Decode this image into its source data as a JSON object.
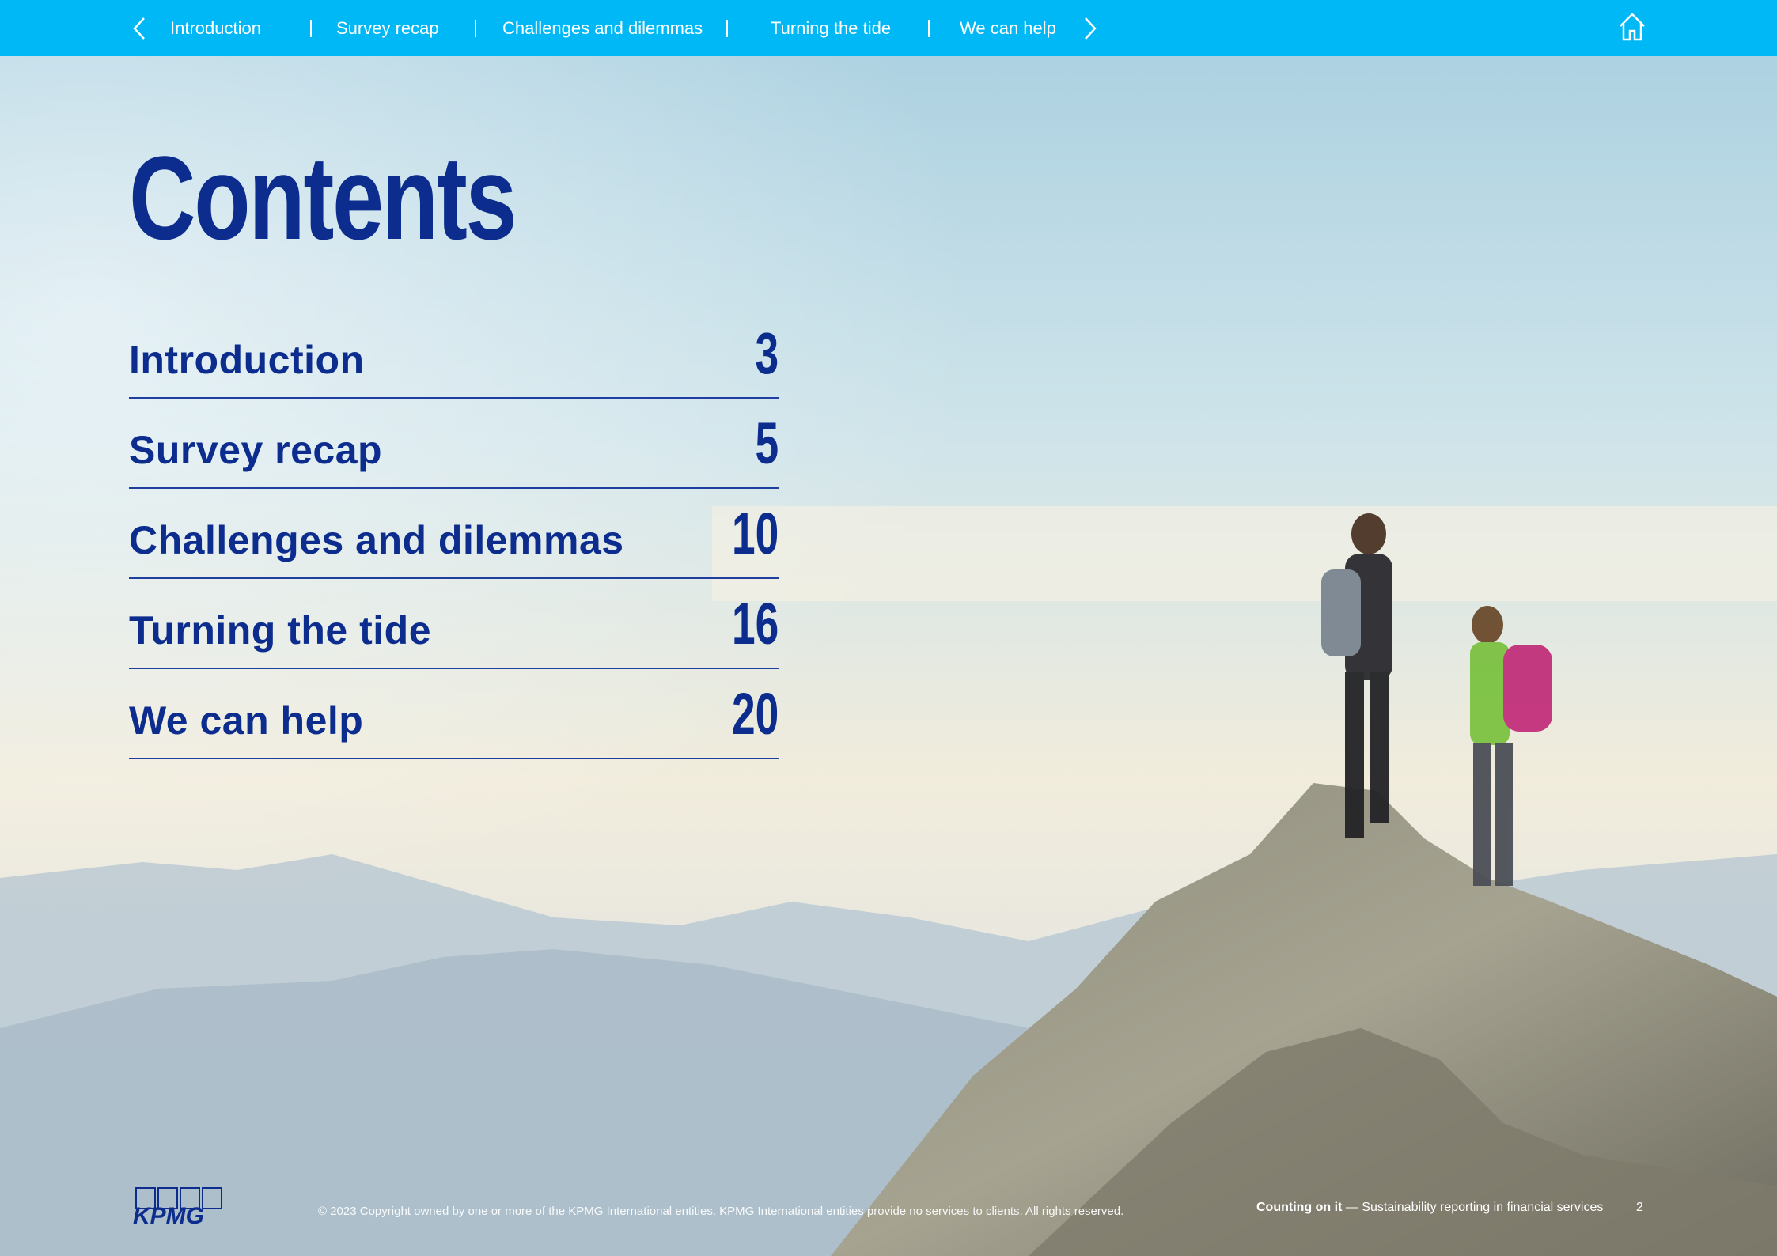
{
  "nav": {
    "items": [
      {
        "label": "Introduction"
      },
      {
        "label": "Survey recap"
      },
      {
        "label": "Challenges and dilemmas"
      },
      {
        "label": "Turning the tide"
      },
      {
        "label": "We can help"
      }
    ],
    "icons": {
      "prev": "chevron-left-icon",
      "next": "chevron-right-icon",
      "home": "home-icon"
    }
  },
  "page": {
    "title": "Contents",
    "toc": [
      {
        "label": "Introduction",
        "page": "3"
      },
      {
        "label": "Survey recap",
        "page": "5"
      },
      {
        "label": "Challenges and dilemmas",
        "page": "10"
      },
      {
        "label": "Turning the tide",
        "page": "16"
      },
      {
        "label": "We can help",
        "page": "20"
      }
    ]
  },
  "footer": {
    "logo_text": "KPMG",
    "copyright": "© 2023 Copyright owned by one or more of the KPMG International entities. KPMG International entities provide no services to clients. All rights reserved.",
    "publication": "Counting on it",
    "separator": " — ",
    "subtitle": "Sustainability reporting in financial services",
    "page_number": "2"
  },
  "colors": {
    "nav_bg": "#00b8f5",
    "heading": "#0c2c8e",
    "rule": "#1e3f9e"
  }
}
